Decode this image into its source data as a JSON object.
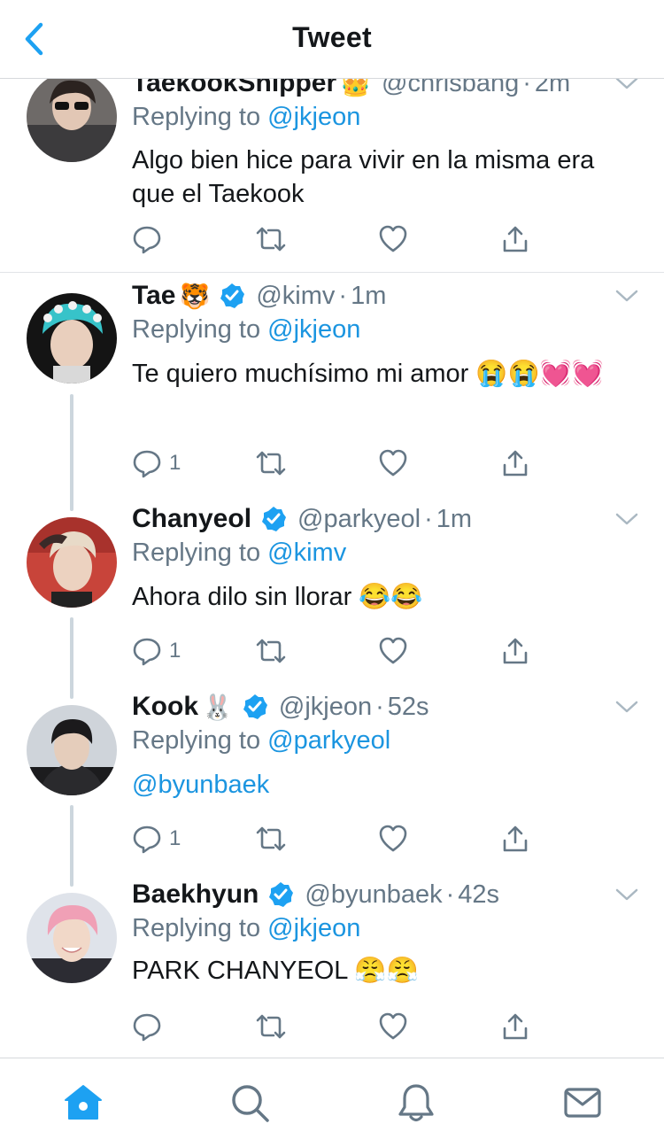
{
  "header": {
    "title": "Tweet"
  },
  "tweets": [
    {
      "name": "TaekookShipper",
      "emoji": "👑",
      "verified": false,
      "handle": "@chrisbang",
      "time": "2m",
      "replying_prefix": "Replying to",
      "replying_to": "@jkjeon",
      "text": "Algo bien hice para vivir en la misma era que el Taekook",
      "replies": ""
    },
    {
      "name": "Tae",
      "emoji": "🐯",
      "verified": true,
      "handle": "@kimv",
      "time": "1m",
      "replying_prefix": "Replying to",
      "replying_to": "@jkjeon",
      "text": "Te quiero muchísimo mi amor 😭😭💓💓",
      "replies": "1"
    },
    {
      "name": "Chanyeol",
      "emoji": "",
      "verified": true,
      "handle": "@parkyeol",
      "time": "1m",
      "replying_prefix": "Replying to",
      "replying_to": "@kimv",
      "text": "Ahora dilo sin llorar 😂😂",
      "replies": "1"
    },
    {
      "name": "Kook",
      "emoji": "🐰",
      "verified": true,
      "handle": "@jkjeon",
      "time": "52s",
      "replying_prefix": "Replying to",
      "replying_to": "@parkyeol",
      "text": "@byunbaek",
      "replies": "1"
    },
    {
      "name": "Baekhyun",
      "emoji": "",
      "verified": true,
      "handle": "@byunbaek",
      "time": "42s",
      "replying_prefix": "Replying to",
      "replying_to": "@jkjeon",
      "text": "PARK CHANYEOL 😤😤",
      "replies": ""
    }
  ],
  "tabbar": {
    "items": [
      "home-icon",
      "search-icon",
      "notifications-icon",
      "messages-icon"
    ],
    "active": "home-icon"
  },
  "colors": {
    "accent": "#1da1f2",
    "link": "#1b95e0",
    "muted": "#657786",
    "divider": "#e1e4e7"
  }
}
